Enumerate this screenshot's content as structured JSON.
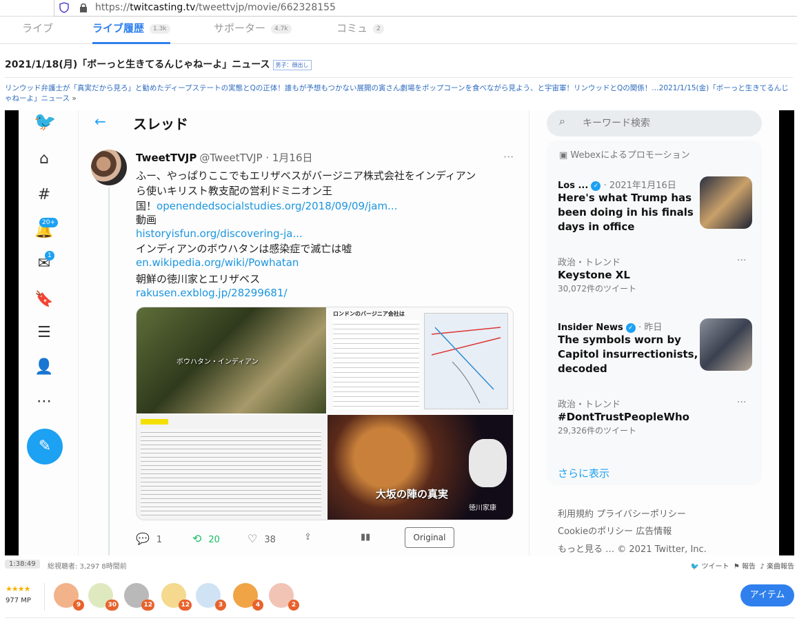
{
  "browser": {
    "url_prefix": "https://",
    "url_domain": "twitcasting.tv",
    "url_path": "/tweettvjp/movie/662328155"
  },
  "tabs": [
    {
      "label": "ライブ",
      "badge": ""
    },
    {
      "label": "ライブ履歴",
      "badge": "1.3k"
    },
    {
      "label": "サポーター",
      "badge": "4.7k"
    },
    {
      "label": "コミュ",
      "badge": "2"
    }
  ],
  "movie": {
    "title": "2021/1/18(月)「ボーっと生きてるんじゃねーよ」ニュース",
    "tag": "男子：顔出し",
    "description": "リンウッド弁護士が「真実だから見ろ」と勧めたディープステートの実態とQの正体！誰もが予想もつかない展開の寅さん劇場をポップコーンを食べながら見よう、と宇宙軍！リンウッドとQの関係！…2021/1/15(金)「ボーっと生きてるんじゃねーよ」ニュース",
    "more": "»"
  },
  "twitter": {
    "thread_title": "スレッド",
    "tweet": {
      "name": "TweetTVJP",
      "handle": "@TweetTVJP · 1月16日",
      "lines": [
        {
          "text": "ふー、やっぱりここでもエリザベスがバージニア株式会社をインディアン",
          "link": false
        },
        {
          "text": "ら使いキリスト教支配の営利ドミニオン王",
          "link": false
        },
        {
          "text": "国！",
          "link": false
        },
        {
          "text": "openendedsocialstudies.org/2018/09/09/jam...",
          "link": true
        },
        {
          "text": "動画",
          "link": false
        },
        {
          "text": "historyisfun.org/discovering-ja...",
          "link": true
        },
        {
          "text": "インディアンのボウハタンは感染症で滅亡は嘘",
          "link": false
        },
        {
          "text": "en.wikipedia.org/wiki/Powhatan",
          "link": true
        },
        {
          "text": "朝鮮の徳川家とエリザベス",
          "link": false
        },
        {
          "text": "rakusen.exblog.jp/28299681/",
          "link": true
        }
      ],
      "media": {
        "img1_caption": "ボウハタン・インディアン",
        "img2_heading": "ロンドンのバージニア会社は",
        "img4_caption": "大坂の陣の真実",
        "img4_caption2": "徳川家康"
      },
      "replies": "1",
      "retweets": "20",
      "likes": "38",
      "original_label": "Original"
    },
    "search_placeholder": "キーワード検索",
    "promo_label": "Webexによるプロモーション",
    "trends": [
      {
        "meta": "Los ...",
        "meta2": "· 2021年1月16日",
        "headline": [
          "Here's what Trump has",
          "been doing in his finals",
          "days in office"
        ],
        "sub": ""
      },
      {
        "meta": "政治・トレンド",
        "meta2": "",
        "headline": [
          "Keystone XL"
        ],
        "sub": "30,072件のツイート"
      },
      {
        "meta": "Insider News",
        "meta2": "· 昨日",
        "headline": [
          "The symbols worn by",
          "Capitol insurrectionists,",
          "decoded"
        ],
        "sub": ""
      },
      {
        "meta": "政治・トレンド",
        "meta2": "",
        "headline": [
          "#DontTrustPeopleWho"
        ],
        "sub": "29,326件のツイート"
      }
    ],
    "show_more": "さらに表示",
    "footer": [
      "利用規約  プライバシーポリシー",
      "Cookieのポリシー  広告情報",
      "もっと見る …  © 2021 Twitter, Inc."
    ],
    "notif_badge": "20+",
    "msg_badge": "1"
  },
  "stats": {
    "duration": "1:38:49",
    "viewers": "総視聴者: 3,297  8時間前",
    "tweet": "ツイート",
    "report": "報告",
    "music_report": "楽曲報告"
  },
  "bottom": {
    "rating_stars": "★★★★",
    "mp": "977 MP",
    "gifts": [
      {
        "name": "clap-gift",
        "count": "9",
        "color": "#f2b38a"
      },
      {
        "name": "drink-gift",
        "count": "30",
        "color": "#dfe9c0"
      },
      {
        "name": "coin-gift",
        "count": "12",
        "color": "#b9b9b9"
      },
      {
        "name": "cup-gift",
        "count": "12",
        "color": "#f4d98e"
      },
      {
        "name": "ghost-gift",
        "count": "3",
        "color": "#cfe3f5"
      },
      {
        "name": "tent-gift",
        "count": "4",
        "color": "#f0a445"
      },
      {
        "name": "cake-gift",
        "count": "2",
        "color": "#f1c4b6"
      }
    ],
    "item_button": "アイテム"
  }
}
